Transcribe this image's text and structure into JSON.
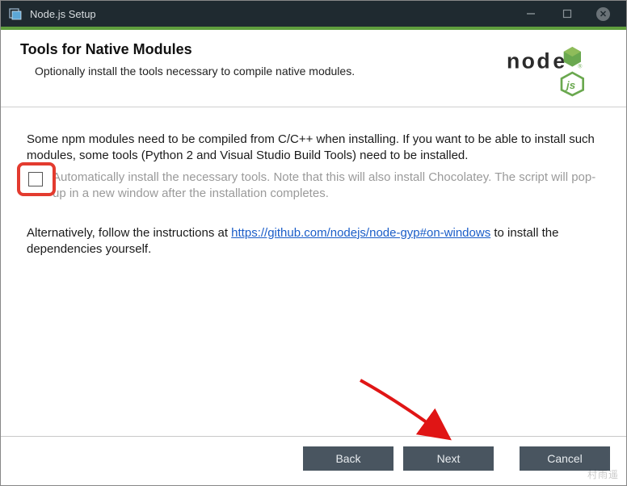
{
  "titlebar": {
    "title": "Node.js Setup"
  },
  "header": {
    "heading": "Tools for Native Modules",
    "subtitle": "Optionally install the tools necessary to compile native modules."
  },
  "body": {
    "para1": "Some npm modules need to be compiled from C/C++ when installing. If you want to be able to install such modules, some tools (Python 2 and Visual Studio Build Tools) need to be installed.",
    "checkbox_label": "Automatically install the necessary tools. Note that this will also install Chocolatey. The script will pop-up in a new window after the installation completes.",
    "alt_prefix": "Alternatively, follow the instructions at ",
    "alt_link": "https://github.com/nodejs/node-gyp#on-windows",
    "alt_suffix": " to install the dependencies yourself."
  },
  "footer": {
    "back": "Back",
    "next": "Next",
    "cancel": "Cancel"
  },
  "watermark": "村雨遥"
}
